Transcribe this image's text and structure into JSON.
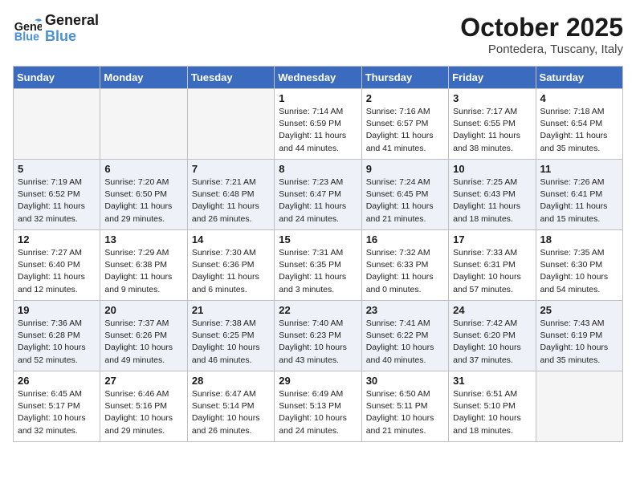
{
  "header": {
    "logo_line1": "General",
    "logo_line2": "Blue",
    "month": "October 2025",
    "location": "Pontedera, Tuscany, Italy"
  },
  "weekdays": [
    "Sunday",
    "Monday",
    "Tuesday",
    "Wednesday",
    "Thursday",
    "Friday",
    "Saturday"
  ],
  "weeks": [
    [
      {
        "day": "",
        "info": ""
      },
      {
        "day": "",
        "info": ""
      },
      {
        "day": "",
        "info": ""
      },
      {
        "day": "1",
        "info": "Sunrise: 7:14 AM\nSunset: 6:59 PM\nDaylight: 11 hours\nand 44 minutes."
      },
      {
        "day": "2",
        "info": "Sunrise: 7:16 AM\nSunset: 6:57 PM\nDaylight: 11 hours\nand 41 minutes."
      },
      {
        "day": "3",
        "info": "Sunrise: 7:17 AM\nSunset: 6:55 PM\nDaylight: 11 hours\nand 38 minutes."
      },
      {
        "day": "4",
        "info": "Sunrise: 7:18 AM\nSunset: 6:54 PM\nDaylight: 11 hours\nand 35 minutes."
      }
    ],
    [
      {
        "day": "5",
        "info": "Sunrise: 7:19 AM\nSunset: 6:52 PM\nDaylight: 11 hours\nand 32 minutes."
      },
      {
        "day": "6",
        "info": "Sunrise: 7:20 AM\nSunset: 6:50 PM\nDaylight: 11 hours\nand 29 minutes."
      },
      {
        "day": "7",
        "info": "Sunrise: 7:21 AM\nSunset: 6:48 PM\nDaylight: 11 hours\nand 26 minutes."
      },
      {
        "day": "8",
        "info": "Sunrise: 7:23 AM\nSunset: 6:47 PM\nDaylight: 11 hours\nand 24 minutes."
      },
      {
        "day": "9",
        "info": "Sunrise: 7:24 AM\nSunset: 6:45 PM\nDaylight: 11 hours\nand 21 minutes."
      },
      {
        "day": "10",
        "info": "Sunrise: 7:25 AM\nSunset: 6:43 PM\nDaylight: 11 hours\nand 18 minutes."
      },
      {
        "day": "11",
        "info": "Sunrise: 7:26 AM\nSunset: 6:41 PM\nDaylight: 11 hours\nand 15 minutes."
      }
    ],
    [
      {
        "day": "12",
        "info": "Sunrise: 7:27 AM\nSunset: 6:40 PM\nDaylight: 11 hours\nand 12 minutes."
      },
      {
        "day": "13",
        "info": "Sunrise: 7:29 AM\nSunset: 6:38 PM\nDaylight: 11 hours\nand 9 minutes."
      },
      {
        "day": "14",
        "info": "Sunrise: 7:30 AM\nSunset: 6:36 PM\nDaylight: 11 hours\nand 6 minutes."
      },
      {
        "day": "15",
        "info": "Sunrise: 7:31 AM\nSunset: 6:35 PM\nDaylight: 11 hours\nand 3 minutes."
      },
      {
        "day": "16",
        "info": "Sunrise: 7:32 AM\nSunset: 6:33 PM\nDaylight: 11 hours\nand 0 minutes."
      },
      {
        "day": "17",
        "info": "Sunrise: 7:33 AM\nSunset: 6:31 PM\nDaylight: 10 hours\nand 57 minutes."
      },
      {
        "day": "18",
        "info": "Sunrise: 7:35 AM\nSunset: 6:30 PM\nDaylight: 10 hours\nand 54 minutes."
      }
    ],
    [
      {
        "day": "19",
        "info": "Sunrise: 7:36 AM\nSunset: 6:28 PM\nDaylight: 10 hours\nand 52 minutes."
      },
      {
        "day": "20",
        "info": "Sunrise: 7:37 AM\nSunset: 6:26 PM\nDaylight: 10 hours\nand 49 minutes."
      },
      {
        "day": "21",
        "info": "Sunrise: 7:38 AM\nSunset: 6:25 PM\nDaylight: 10 hours\nand 46 minutes."
      },
      {
        "day": "22",
        "info": "Sunrise: 7:40 AM\nSunset: 6:23 PM\nDaylight: 10 hours\nand 43 minutes."
      },
      {
        "day": "23",
        "info": "Sunrise: 7:41 AM\nSunset: 6:22 PM\nDaylight: 10 hours\nand 40 minutes."
      },
      {
        "day": "24",
        "info": "Sunrise: 7:42 AM\nSunset: 6:20 PM\nDaylight: 10 hours\nand 37 minutes."
      },
      {
        "day": "25",
        "info": "Sunrise: 7:43 AM\nSunset: 6:19 PM\nDaylight: 10 hours\nand 35 minutes."
      }
    ],
    [
      {
        "day": "26",
        "info": "Sunrise: 6:45 AM\nSunset: 5:17 PM\nDaylight: 10 hours\nand 32 minutes."
      },
      {
        "day": "27",
        "info": "Sunrise: 6:46 AM\nSunset: 5:16 PM\nDaylight: 10 hours\nand 29 minutes."
      },
      {
        "day": "28",
        "info": "Sunrise: 6:47 AM\nSunset: 5:14 PM\nDaylight: 10 hours\nand 26 minutes."
      },
      {
        "day": "29",
        "info": "Sunrise: 6:49 AM\nSunset: 5:13 PM\nDaylight: 10 hours\nand 24 minutes."
      },
      {
        "day": "30",
        "info": "Sunrise: 6:50 AM\nSunset: 5:11 PM\nDaylight: 10 hours\nand 21 minutes."
      },
      {
        "day": "31",
        "info": "Sunrise: 6:51 AM\nSunset: 5:10 PM\nDaylight: 10 hours\nand 18 minutes."
      },
      {
        "day": "",
        "info": ""
      }
    ]
  ]
}
